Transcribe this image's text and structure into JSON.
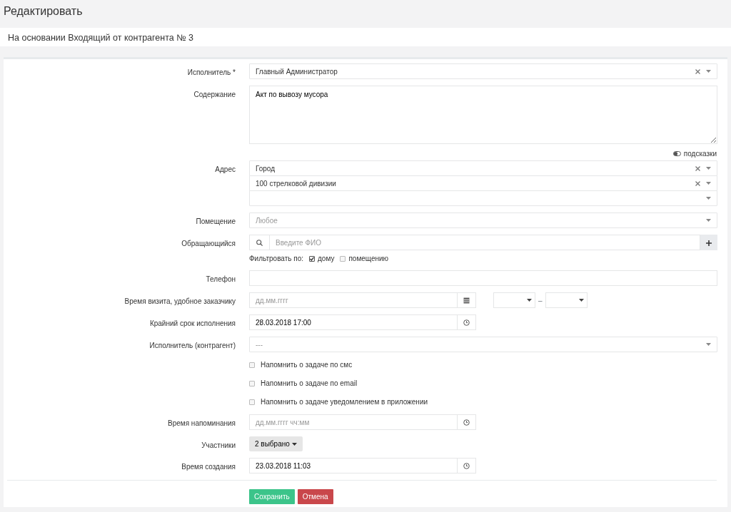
{
  "page_title": "Редактировать",
  "subtitle": "На основании Входящий от контрагента № 3",
  "fields": [
    {
      "kind": "select",
      "label": "Исполнитель *",
      "value": "Главный Администратор",
      "clearable": true
    },
    {
      "kind": "textarea",
      "label": "Содержание",
      "value": "Акт по вывозу мусора"
    },
    {
      "kind": "hints",
      "text": "подсказки",
      "on": false
    },
    {
      "kind": "address",
      "label": "Адрес",
      "selects": [
        {
          "value": "Город",
          "clearable": true
        },
        {
          "value": "100 стрелковой дивизии",
          "clearable": true
        },
        {
          "clearable": false
        }
      ]
    },
    {
      "kind": "select",
      "label": "Помещение",
      "placeholder": "Любое",
      "clearable": false
    },
    {
      "kind": "person",
      "label": "Обращающийся",
      "placeholder": "Введите ФИО",
      "filter_label": "Фильтровать по:",
      "filters": [
        {
          "text": "дому",
          "checked": true
        },
        {
          "text": "помещению",
          "checked": false
        }
      ]
    },
    {
      "kind": "text",
      "label": "Телефон"
    },
    {
      "kind": "date_range",
      "label": "Время визита, удобное заказчику",
      "placeholder": "дд.мм.гггг",
      "separator": "–"
    },
    {
      "kind": "datetime",
      "label": "Крайний срок исполнения",
      "value": "28.03.2018 17:00"
    },
    {
      "kind": "native_select",
      "label": "Исполнитель (контрагент)",
      "placeholder": "---"
    },
    {
      "kind": "checkbox",
      "text": "Напомнить о задаче по смс",
      "checked": false
    },
    {
      "kind": "checkbox",
      "text": "Напомнить о задаче по email",
      "checked": false
    },
    {
      "kind": "checkbox",
      "text": "Напомнить о задаче уведомлением в приложении",
      "checked": false
    },
    {
      "kind": "datetime",
      "label": "Время напоминания",
      "placeholder": "дд.мм.гггг чч:мм"
    },
    {
      "kind": "dropdown",
      "label": "Участники",
      "value": "2 выбрано"
    },
    {
      "kind": "datetime",
      "label": "Время создания",
      "value": "23.03.2018 11:03"
    }
  ],
  "buttons": [
    {
      "label": "Сохранить",
      "kind": "success"
    },
    {
      "label": "Отмена",
      "kind": "danger"
    }
  ]
}
